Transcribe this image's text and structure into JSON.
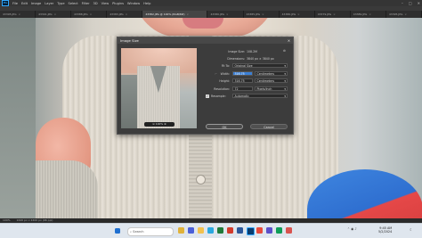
{
  "menubar": {
    "app_icon": "Ps",
    "items": [
      "File",
      "Edit",
      "Image",
      "Layer",
      "Type",
      "Select",
      "Filter",
      "3D",
      "View",
      "Plugins",
      "Window",
      "Help"
    ]
  },
  "tabs": [
    {
      "label": "43395.JPG",
      "active": false
    },
    {
      "label": "43391.JPG",
      "active": false
    },
    {
      "label": "43388.JPG",
      "active": false
    },
    {
      "label": "43383.JPG",
      "active": false
    },
    {
      "label": "43382.JPG @ 100% (RGB/8#)",
      "active": true
    },
    {
      "label": "43380.JPG",
      "active": false
    },
    {
      "label": "43385.JPG",
      "active": false
    },
    {
      "label": "43386.JPG",
      "active": false
    },
    {
      "label": "43379.JPG",
      "active": false
    },
    {
      "label": "43389.JPG",
      "active": false
    },
    {
      "label": "43395.JPG",
      "active": false
    }
  ],
  "statusbar": {
    "zoom": "100%",
    "doc_info": "1620 px x 2400 px (96 ppi)"
  },
  "dialog": {
    "title": "Image Size",
    "image_size_label": "Image Size:",
    "image_size_value": "108.2M",
    "dimensions_label": "Dimensions:",
    "dimensions_value": "3840 px  ×  3840 px",
    "fit_to_label": "Fit To:",
    "fit_to_value": "Original Size",
    "width_label": "Width:",
    "width_value": "316.75",
    "width_unit": "Centimeters",
    "height_label": "Height:",
    "height_value": "316.75",
    "height_unit": "Centimeters",
    "resolution_label": "Resolution:",
    "resolution_value": "72",
    "resolution_unit": "Pixels/Inch",
    "resample_label": "Resample:",
    "resample_value": "Automatic",
    "ok_label": "OK",
    "cancel_label": "Cancel",
    "preview_zoom": "100%"
  },
  "taskbar": {
    "search_placeholder": "Search",
    "time": "9:45 AM",
    "date": "5/2/2024"
  }
}
